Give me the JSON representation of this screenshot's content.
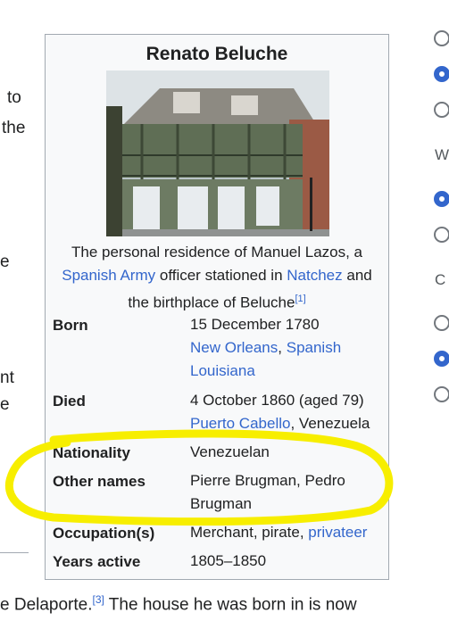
{
  "left_fragments": [
    "to",
    "the",
    "e",
    "nt",
    "e"
  ],
  "infobox": {
    "title": "Renato Beluche",
    "caption": {
      "pre": "The personal residence of Manuel Lazos, a",
      "link1": "Spanish Army",
      "mid1": "officer stationed in",
      "link2": "Natchez",
      "mid2": "and the birthplace of Beluche",
      "ref": "[1]"
    },
    "born": {
      "label": "Born",
      "date": "15 December 1780",
      "place_link1": "New Orleans",
      "sep": ",",
      "place_link2": "Spanish Louisiana"
    },
    "died": {
      "label": "Died",
      "date": "4 October 1860 (aged 79)",
      "place_link": "Puerto Cabello",
      "place_rest": ", Venezuela"
    },
    "nationality": {
      "label": "Nationality",
      "value": "Venezuelan"
    },
    "other_names": {
      "label": "Other names",
      "value": "Pierre Brugman, Pedro Brugman"
    },
    "occupation": {
      "label": "Occupation(s)",
      "value": "Merchant, pirate,",
      "link": "privateer"
    },
    "years_active": {
      "label": "Years active",
      "value": "1805–1850"
    }
  },
  "body_text": {
    "pre": "e Delaporte.",
    "ref": "[3]",
    "post": "The house he was born in is now"
  },
  "rail": {
    "letters": [
      "W",
      "C"
    ],
    "radio_states": [
      "off",
      "on",
      "off",
      "on",
      "off",
      "off",
      "on",
      "off"
    ]
  },
  "colors": {
    "link": "#3366cc",
    "highlight": "#f7ee00",
    "infobox_bg": "#f8f9fa"
  }
}
